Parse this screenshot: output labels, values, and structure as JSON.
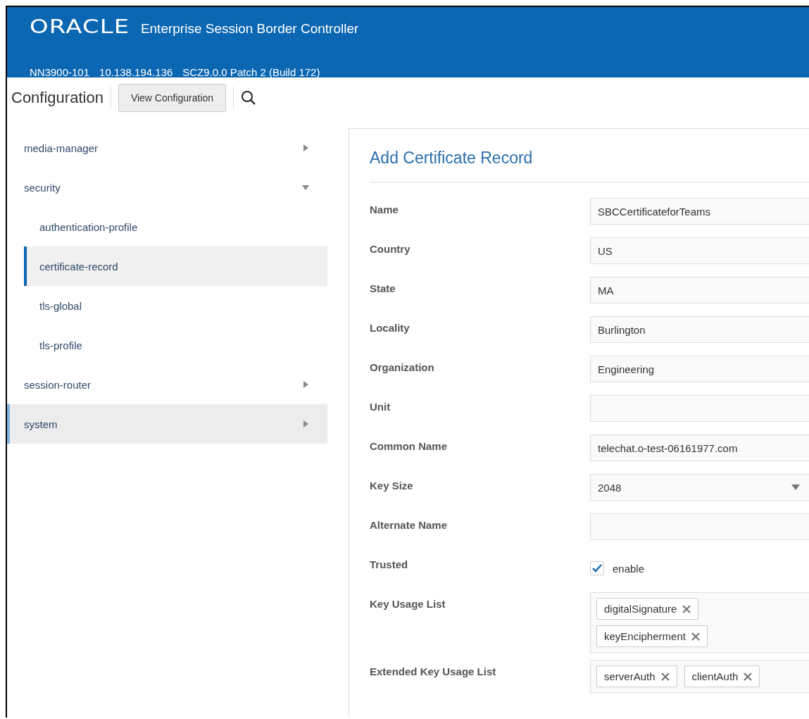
{
  "header": {
    "logo": "ORACLE",
    "product": "Enterprise Session Border Controller",
    "device": "NN3900-101",
    "address": "10.138.194.136",
    "version": "SCZ9.0.0 Patch 2 (Build 172)"
  },
  "toolbar": {
    "title": "Configuration",
    "button": "View Configuration"
  },
  "sidebar": {
    "items": [
      {
        "label": "media-manager",
        "expanded": false,
        "selected": false,
        "hovered": false
      },
      {
        "label": "security",
        "expanded": true,
        "selected": false,
        "hovered": false,
        "children": [
          {
            "label": "authentication-profile",
            "selected": false
          },
          {
            "label": "certificate-record",
            "selected": true
          },
          {
            "label": "tls-global",
            "selected": false
          },
          {
            "label": "tls-profile",
            "selected": false
          }
        ]
      },
      {
        "label": "session-router",
        "expanded": false,
        "selected": false,
        "hovered": false
      },
      {
        "label": "system",
        "expanded": false,
        "selected": false,
        "hovered": true
      }
    ]
  },
  "form": {
    "title": "Add Certificate Record",
    "fields": [
      {
        "kind": "text",
        "label": "Name",
        "value": "SBCCertificateforTeams"
      },
      {
        "kind": "text",
        "label": "Country",
        "value": "US"
      },
      {
        "kind": "text",
        "label": "State",
        "value": "MA"
      },
      {
        "kind": "text",
        "label": "Locality",
        "value": "Burlington"
      },
      {
        "kind": "text",
        "label": "Organization",
        "value": "Engineering"
      },
      {
        "kind": "text",
        "label": "Unit"
      },
      {
        "kind": "text",
        "label": "Common Name",
        "value": "telechat.o-test-06161977.com"
      },
      {
        "kind": "select",
        "label": "Key Size",
        "value": "2048"
      },
      {
        "kind": "text",
        "label": "Alternate Name"
      },
      {
        "kind": "checkbox",
        "label": "Trusted",
        "checked": true,
        "text": "enable"
      },
      {
        "kind": "tags",
        "label": "Key Usage List",
        "stacked": true,
        "tags": [
          "digitalSignature",
          "keyEncipherment"
        ]
      },
      {
        "kind": "tags",
        "label": "Extended Key Usage List",
        "stacked": false,
        "tags": [
          "serverAuth",
          "clientAuth"
        ]
      }
    ]
  }
}
